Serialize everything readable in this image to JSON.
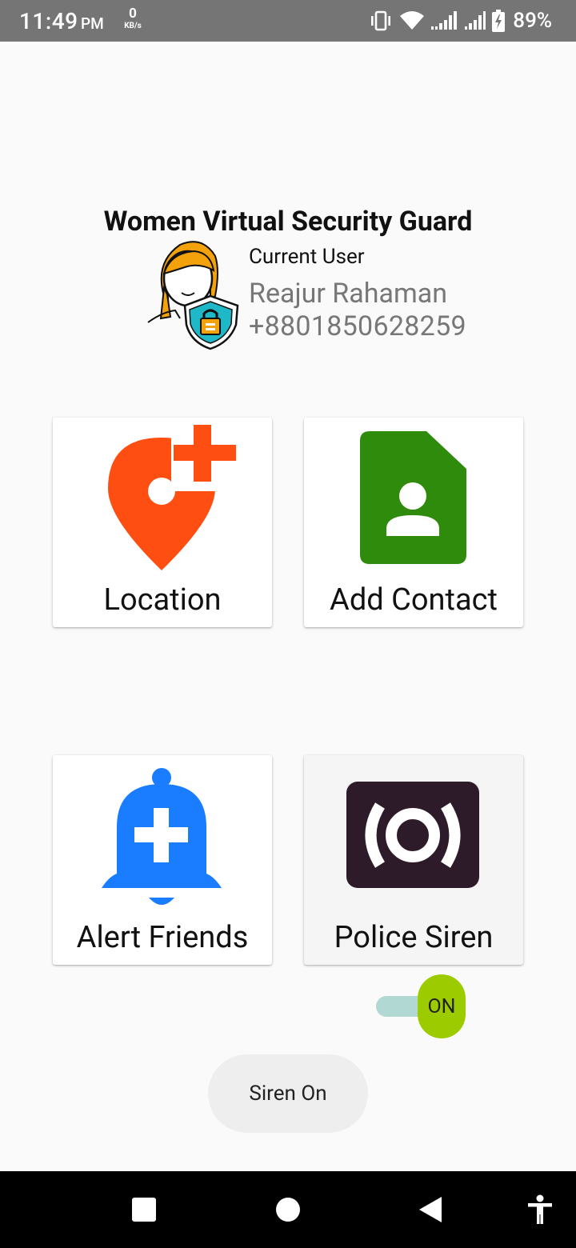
{
  "status_bar": {
    "time": "11:49",
    "ampm": "PM",
    "net_speed_value": "0",
    "net_speed_unit": "KB/s",
    "battery_percent": "89%",
    "icons": [
      "vibrate-icon",
      "wifi-icon",
      "signal-icon",
      "signal-icon",
      "battery-charging-icon"
    ]
  },
  "header": {
    "title": "Women Virtual Security Guard",
    "avatar_icon": "woman-shield-lock-icon"
  },
  "user": {
    "caption": "Current User",
    "name": "Reajur Rahaman",
    "phone": "+8801850628259"
  },
  "cards": [
    {
      "label": "Location",
      "icon": "location-add-icon",
      "color": "#ff4e12"
    },
    {
      "label": "Add Contact",
      "icon": "contact-card-icon",
      "color": "#2e8b0c"
    },
    {
      "label": "Alert Friends",
      "icon": "bell-plus-icon",
      "color": "#1a7cff"
    },
    {
      "label": "Police Siren",
      "icon": "siren-broadcast-icon",
      "color": "#2d1b2a"
    }
  ],
  "siren_switch": {
    "state_label": "ON",
    "checked": true,
    "thumb_color": "#9ccc00",
    "track_color": "#b2d8d3"
  },
  "siren_button": {
    "label": "Siren On"
  },
  "nav_bar": {
    "icons": [
      "square-recents-icon",
      "circle-home-icon",
      "triangle-back-icon",
      "accessibility-icon"
    ]
  }
}
